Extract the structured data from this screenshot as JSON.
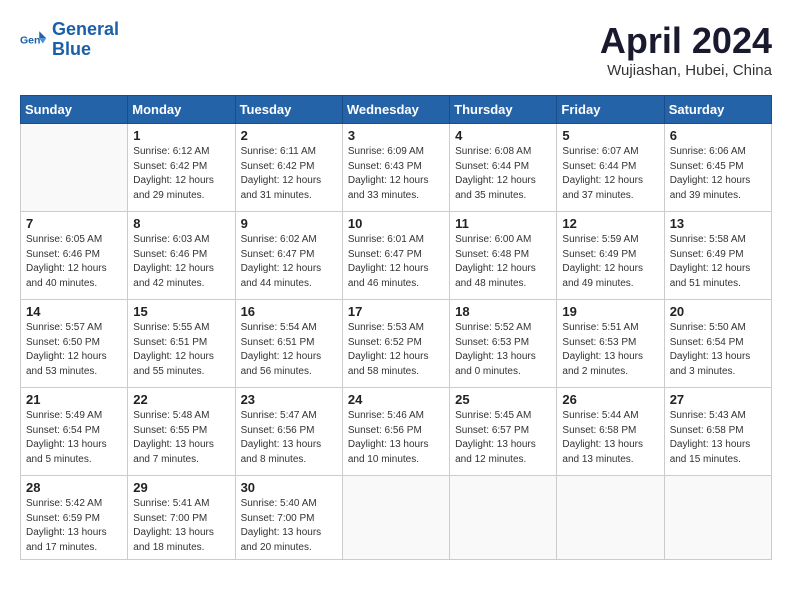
{
  "header": {
    "logo_line1": "General",
    "logo_line2": "Blue",
    "month": "April 2024",
    "location": "Wujiashan, Hubei, China"
  },
  "columns": [
    "Sunday",
    "Monday",
    "Tuesday",
    "Wednesday",
    "Thursday",
    "Friday",
    "Saturday"
  ],
  "weeks": [
    [
      {
        "day": "",
        "info": ""
      },
      {
        "day": "1",
        "info": "Sunrise: 6:12 AM\nSunset: 6:42 PM\nDaylight: 12 hours\nand 29 minutes."
      },
      {
        "day": "2",
        "info": "Sunrise: 6:11 AM\nSunset: 6:42 PM\nDaylight: 12 hours\nand 31 minutes."
      },
      {
        "day": "3",
        "info": "Sunrise: 6:09 AM\nSunset: 6:43 PM\nDaylight: 12 hours\nand 33 minutes."
      },
      {
        "day": "4",
        "info": "Sunrise: 6:08 AM\nSunset: 6:44 PM\nDaylight: 12 hours\nand 35 minutes."
      },
      {
        "day": "5",
        "info": "Sunrise: 6:07 AM\nSunset: 6:44 PM\nDaylight: 12 hours\nand 37 minutes."
      },
      {
        "day": "6",
        "info": "Sunrise: 6:06 AM\nSunset: 6:45 PM\nDaylight: 12 hours\nand 39 minutes."
      }
    ],
    [
      {
        "day": "7",
        "info": "Sunrise: 6:05 AM\nSunset: 6:46 PM\nDaylight: 12 hours\nand 40 minutes."
      },
      {
        "day": "8",
        "info": "Sunrise: 6:03 AM\nSunset: 6:46 PM\nDaylight: 12 hours\nand 42 minutes."
      },
      {
        "day": "9",
        "info": "Sunrise: 6:02 AM\nSunset: 6:47 PM\nDaylight: 12 hours\nand 44 minutes."
      },
      {
        "day": "10",
        "info": "Sunrise: 6:01 AM\nSunset: 6:47 PM\nDaylight: 12 hours\nand 46 minutes."
      },
      {
        "day": "11",
        "info": "Sunrise: 6:00 AM\nSunset: 6:48 PM\nDaylight: 12 hours\nand 48 minutes."
      },
      {
        "day": "12",
        "info": "Sunrise: 5:59 AM\nSunset: 6:49 PM\nDaylight: 12 hours\nand 49 minutes."
      },
      {
        "day": "13",
        "info": "Sunrise: 5:58 AM\nSunset: 6:49 PM\nDaylight: 12 hours\nand 51 minutes."
      }
    ],
    [
      {
        "day": "14",
        "info": "Sunrise: 5:57 AM\nSunset: 6:50 PM\nDaylight: 12 hours\nand 53 minutes."
      },
      {
        "day": "15",
        "info": "Sunrise: 5:55 AM\nSunset: 6:51 PM\nDaylight: 12 hours\nand 55 minutes."
      },
      {
        "day": "16",
        "info": "Sunrise: 5:54 AM\nSunset: 6:51 PM\nDaylight: 12 hours\nand 56 minutes."
      },
      {
        "day": "17",
        "info": "Sunrise: 5:53 AM\nSunset: 6:52 PM\nDaylight: 12 hours\nand 58 minutes."
      },
      {
        "day": "18",
        "info": "Sunrise: 5:52 AM\nSunset: 6:53 PM\nDaylight: 13 hours\nand 0 minutes."
      },
      {
        "day": "19",
        "info": "Sunrise: 5:51 AM\nSunset: 6:53 PM\nDaylight: 13 hours\nand 2 minutes."
      },
      {
        "day": "20",
        "info": "Sunrise: 5:50 AM\nSunset: 6:54 PM\nDaylight: 13 hours\nand 3 minutes."
      }
    ],
    [
      {
        "day": "21",
        "info": "Sunrise: 5:49 AM\nSunset: 6:54 PM\nDaylight: 13 hours\nand 5 minutes."
      },
      {
        "day": "22",
        "info": "Sunrise: 5:48 AM\nSunset: 6:55 PM\nDaylight: 13 hours\nand 7 minutes."
      },
      {
        "day": "23",
        "info": "Sunrise: 5:47 AM\nSunset: 6:56 PM\nDaylight: 13 hours\nand 8 minutes."
      },
      {
        "day": "24",
        "info": "Sunrise: 5:46 AM\nSunset: 6:56 PM\nDaylight: 13 hours\nand 10 minutes."
      },
      {
        "day": "25",
        "info": "Sunrise: 5:45 AM\nSunset: 6:57 PM\nDaylight: 13 hours\nand 12 minutes."
      },
      {
        "day": "26",
        "info": "Sunrise: 5:44 AM\nSunset: 6:58 PM\nDaylight: 13 hours\nand 13 minutes."
      },
      {
        "day": "27",
        "info": "Sunrise: 5:43 AM\nSunset: 6:58 PM\nDaylight: 13 hours\nand 15 minutes."
      }
    ],
    [
      {
        "day": "28",
        "info": "Sunrise: 5:42 AM\nSunset: 6:59 PM\nDaylight: 13 hours\nand 17 minutes."
      },
      {
        "day": "29",
        "info": "Sunrise: 5:41 AM\nSunset: 7:00 PM\nDaylight: 13 hours\nand 18 minutes."
      },
      {
        "day": "30",
        "info": "Sunrise: 5:40 AM\nSunset: 7:00 PM\nDaylight: 13 hours\nand 20 minutes."
      },
      {
        "day": "",
        "info": ""
      },
      {
        "day": "",
        "info": ""
      },
      {
        "day": "",
        "info": ""
      },
      {
        "day": "",
        "info": ""
      }
    ]
  ]
}
